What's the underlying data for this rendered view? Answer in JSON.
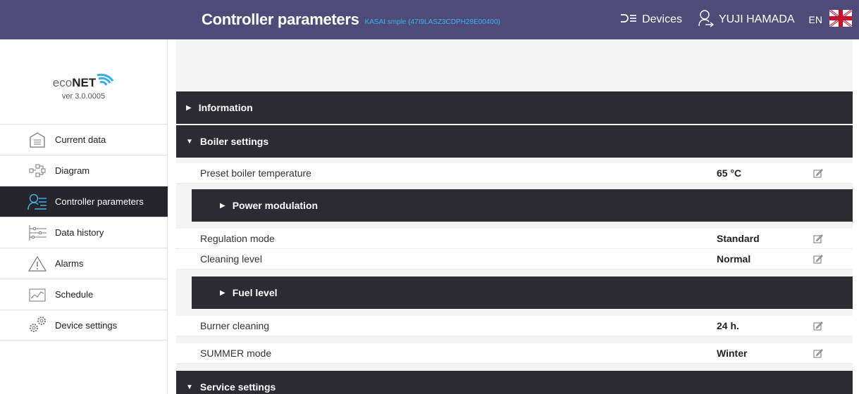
{
  "header": {
    "title": "Controller parameters",
    "subtitle": "KASAI smple (47I9LASZ3CDPH28E00400)",
    "devices_label": "Devices",
    "user_name": "YUJI HAMADA",
    "language": "EN"
  },
  "sidebar": {
    "logo_eco": "eco",
    "logo_net": "NET",
    "version": "ver 3.0.0005",
    "items": [
      {
        "label": "Current data",
        "icon": "current-data-icon"
      },
      {
        "label": "Diagram",
        "icon": "diagram-icon"
      },
      {
        "label": "Controller parameters",
        "icon": "controller-parameters-icon",
        "active": true
      },
      {
        "label": "Data history",
        "icon": "data-history-icon"
      },
      {
        "label": "Alarms",
        "icon": "alarm-icon"
      },
      {
        "label": "Schedule",
        "icon": "schedule-icon"
      },
      {
        "label": "Device settings",
        "icon": "device-settings-icon"
      }
    ]
  },
  "main": {
    "sections": {
      "information": "Information",
      "boiler_settings": "Boiler settings",
      "power_modulation": "Power modulation",
      "fuel_level": "Fuel level",
      "service_settings": "Service settings"
    },
    "params": {
      "preset_boiler_temp": {
        "label": "Preset boiler temperature",
        "value": "65 °C"
      },
      "regulation_mode": {
        "label": "Regulation mode",
        "value": "Standard"
      },
      "cleaning_level": {
        "label": "Cleaning level",
        "value": "Normal"
      },
      "burner_cleaning": {
        "label": "Burner cleaning",
        "value": "24 h."
      },
      "summer_mode": {
        "label": "SUMMER mode",
        "value": "Winter"
      }
    }
  },
  "colors": {
    "topbar": "#4e4b78",
    "section_header": "#2b2b31",
    "active_menu": "#25252b",
    "accent": "#38b6e8"
  }
}
